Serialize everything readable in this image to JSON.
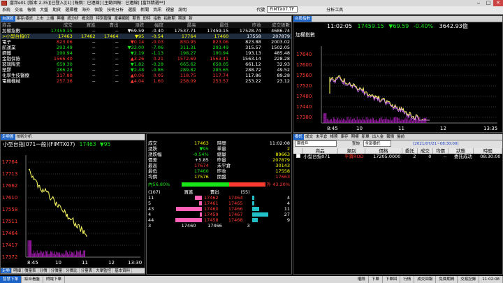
{
  "window": {
    "title": "富邦e01 [版本 2.35][已登入][1] [報價：已連線] [主動回報：已連線] [富邦精選**]"
  },
  "menu": [
    "系統",
    "交易",
    "報價",
    "大盤",
    "期貨",
    "選擇權",
    "海外",
    "個股",
    "技術分析",
    "選股",
    "新聞",
    "資訊",
    "視窗",
    "說明"
  ],
  "menu_symbol_label": "代號",
  "menu_symbol_value": "FIMTX07.TF",
  "menu_tools": "分析工具",
  "quote": {
    "tabs": [
      "自選股",
      "庫存/委託",
      "上市",
      "上櫃",
      "興櫃",
      "統分析",
      "概念股",
      "特別報價",
      "產業類股",
      "期貨",
      "即時",
      "指數",
      "指數期",
      "期選",
      "新"
    ],
    "columns": [
      "商品",
      "成交",
      "買進",
      "賣出",
      "漲跌",
      "幅度",
      "最高",
      "最低",
      "昨收",
      "成交張數"
    ],
    "rows": [
      [
        "加權指數",
        "17459.15",
        "--",
        "--",
        "▼69.59",
        "-0.40",
        "17537.71",
        "17459.15",
        "17528.74",
        "4686.74"
      ],
      [
        ">小型台指07",
        "17463",
        "17462",
        "17464",
        "▼95",
        "-0.54",
        "17764",
        "17460",
        "17558",
        "207879"
      ],
      [
        "電子",
        "823.06",
        "--",
        "--",
        "▼0.14",
        "-0.03",
        "830.95",
        "823.06",
        "823.88",
        "2003.02"
      ],
      [
        "航運業",
        "293.49",
        "--",
        "--",
        "▼22.00",
        "-7.06",
        "311.31",
        "293.49",
        "315.57",
        "1502.05"
      ],
      [
        "鋼鐵",
        "190.94",
        "--",
        "--",
        "▼2.19",
        "-1.13",
        "198.27",
        "190.94",
        "193.13",
        "485.48"
      ],
      [
        "金融保險",
        "1566.40",
        "--",
        "--",
        "▲3.26",
        "0.21",
        "1572.69",
        "1563.41",
        "1563.14",
        "228.28"
      ],
      [
        "玻璃陶瓷",
        "659.30",
        "--",
        "--",
        "▼1.82",
        "-0.28",
        "665.62",
        "658.05",
        "661.12",
        "32.93"
      ],
      [
        "塑膠",
        "286.24",
        "--",
        "--",
        "▼2.48",
        "-0.86",
        "289.82",
        "285.65",
        "288.72",
        "49.52"
      ],
      [
        "化學生技醫療",
        "117.80",
        "--",
        "--",
        "▲0.06",
        "0.05",
        "118.75",
        "117.74",
        "117.86",
        "89.28"
      ],
      [
        "電機機械",
        "257.36",
        "--",
        "--",
        "▲4.04",
        "1.60",
        "258.09",
        "253.57",
        "253.22",
        "23.12"
      ]
    ],
    "row_colors": [
      "wht",
      "yel",
      "red",
      "grn",
      "grn",
      "red",
      "grn",
      "grn",
      "red",
      "red"
    ]
  },
  "index_chart": {
    "tab": "台股指數",
    "time": "11:02:05",
    "price": "17459.15",
    "change": "▼69.59",
    "pct": "-0.40%",
    "volume": "3642.93億",
    "name": "加權指數",
    "y_ticks": [
      "17640",
      "17600",
      "17560",
      "17520",
      "17480",
      "17440",
      "17380"
    ],
    "x_ticks": [
      "8:45",
      "10",
      "11",
      "12",
      "13:35"
    ]
  },
  "futures_chart": {
    "tabs": [
      "走勢圖",
      "技術分析"
    ],
    "title": "小型台指(071一般)(FIMTX07)",
    "price": "17463",
    "change": "▼95",
    "y_ticks": [
      "17764",
      "17713",
      "17662",
      "17610",
      "17558",
      "17511",
      "17464",
      "17417",
      "17372"
    ],
    "x_ticks": [
      "8:45",
      "10",
      "11",
      "12",
      "13:30"
    ],
    "bottom_tabs": [
      "走勢",
      "明細",
      "價量表",
      "分價",
      "分價量",
      "分價比",
      "分量表",
      "大單監控",
      "基本資料"
    ]
  },
  "detail": {
    "fields": [
      [
        "成交",
        "17463",
        "時間",
        "11:02:08"
      ],
      [
        "漲跌",
        "▼95",
        "單量",
        "2"
      ],
      [
        "漲跌幅",
        "-0.54%",
        "總量",
        "89663"
      ],
      [
        "價差",
        "+5.85",
        "昨量",
        "207879"
      ],
      [
        "最高",
        "17674",
        "未平倉",
        "30143"
      ],
      [
        "最低",
        "17460",
        "昨收",
        "17558"
      ],
      [
        "均價",
        "17576",
        "開盤",
        "17663"
      ]
    ],
    "ratio_left": "內56.80%",
    "ratio_right": "外 43.20%",
    "ratio_left_pct": 56.8,
    "book_header": [
      "(107)",
      "買進",
      "賣出",
      "(55)"
    ],
    "book": [
      [
        "11",
        "17462",
        "17464",
        "4"
      ],
      [
        "5",
        "17461",
        "17465",
        "4"
      ],
      [
        "43",
        "17460",
        "17466",
        "11"
      ],
      [
        "4",
        "17459",
        "17467",
        "27"
      ],
      [
        "44",
        "17458",
        "17468",
        "9"
      ]
    ],
    "book_total": [
      "3",
      "17460",
      "17466",
      "3"
    ]
  },
  "orders": {
    "tabs": [
      "委託",
      "成交",
      "未平倉",
      "帳務",
      "庫存",
      "期權",
      "新單",
      "出入金",
      "報價",
      "盤前"
    ],
    "account": "期貨戶",
    "query_label": "查詢",
    "filter": "全部委託",
    "date_label": "[2021/07/21~08:30:00]",
    "columns": [
      "",
      "商品",
      "類別",
      "價格",
      "委託",
      "成交",
      "均價",
      "狀態",
      "時間"
    ],
    "rows": [
      [
        "",
        "小型台指071",
        "平賣ROD",
        "17205.0000",
        "2",
        "0",
        "--",
        "委託成功",
        "08:30:00"
      ]
    ]
  },
  "status": {
    "items": [
      "智慧下單",
      "綜合看盤",
      "閃電下單"
    ],
    "right": [
      "權限",
      "下單",
      "下單回",
      "行情",
      "成交回報",
      "免費期間",
      "交易記錄"
    ],
    "time": "11:02:08"
  }
}
